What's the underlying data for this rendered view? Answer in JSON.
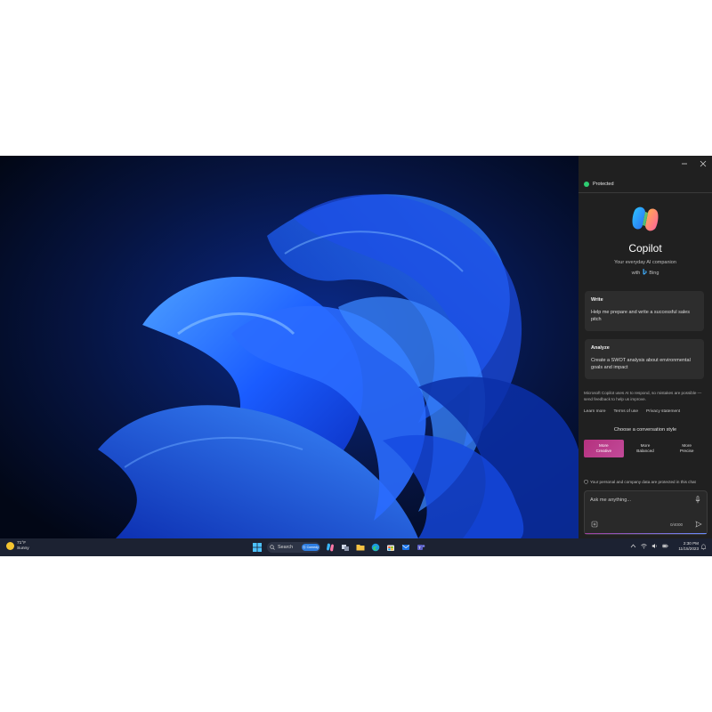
{
  "copilot": {
    "status": "Protected",
    "title": "Copilot",
    "subtitle": "Your everyday AI companion",
    "with_prefix": "with",
    "with_brand": "Bing",
    "cards": [
      {
        "title": "Write",
        "text": "Help me prepare and write a successful sales pitch"
      },
      {
        "title": "Analyze",
        "text": "Create a SWOT analysis about environmental goals and impact"
      }
    ],
    "disclaimer": "Microsoft Copilot uses AI to respond, so mistakes are possible — send feedback to help us improve.",
    "links": [
      "Learn more",
      "Terms of use",
      "Privacy statement"
    ],
    "style_heading": "Choose a conversation style",
    "styles": [
      {
        "line1": "More",
        "line2": "Creative",
        "active": true
      },
      {
        "line1": "More",
        "line2": "Balanced",
        "active": false
      },
      {
        "line1": "More",
        "line2": "Precise",
        "active": false
      }
    ],
    "privacy_note": "Your personal and company data are protected in this chat",
    "input_placeholder": "Ask me anything...",
    "char_counter": "0/4000"
  },
  "taskbar": {
    "weather_temp": "71°F",
    "weather_desc": "Sunny",
    "search_label": "Search",
    "search_badge": "Ⓢ Comedy",
    "time": "2:30 PM",
    "date": "11/15/2023"
  },
  "colors": {
    "panel_bg": "#202020",
    "card_bg": "#2d2d2d",
    "accent_creative": "#b4317e",
    "protected_dot": "#2ecc71",
    "taskbar_bg": "#1c2232"
  }
}
